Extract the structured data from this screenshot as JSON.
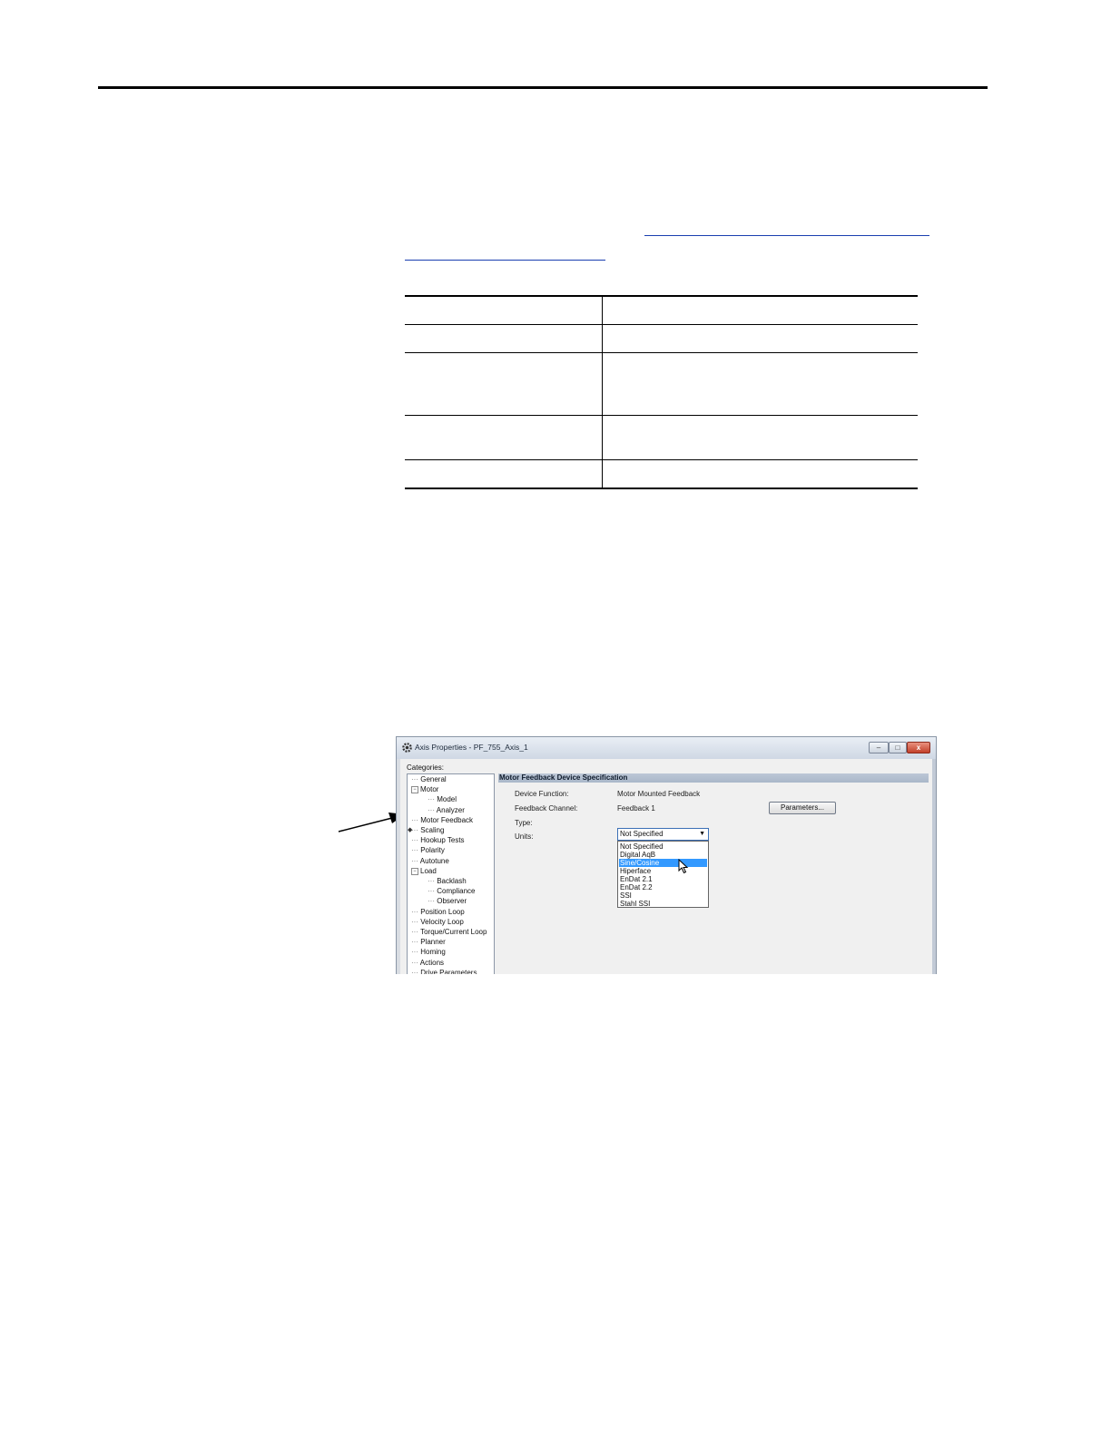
{
  "window": {
    "title": "Axis Properties - PF_755_Axis_1",
    "minimize": "–",
    "maximize": "□",
    "close": "x"
  },
  "categories": {
    "label": "Categories:",
    "items": [
      {
        "label": "General",
        "level": 0
      },
      {
        "label": "Motor",
        "level": 0,
        "expander": "−"
      },
      {
        "label": "Model",
        "level": 1
      },
      {
        "label": "Analyzer",
        "level": 1
      },
      {
        "label": "Motor Feedback",
        "level": 0
      },
      {
        "label": "Scaling",
        "level": 0
      },
      {
        "label": "Hookup Tests",
        "level": 0
      },
      {
        "label": "Polarity",
        "level": 0
      },
      {
        "label": "Autotune",
        "level": 0
      },
      {
        "label": "Load",
        "level": 0,
        "expander": "−"
      },
      {
        "label": "Backlash",
        "level": 1
      },
      {
        "label": "Compliance",
        "level": 1
      },
      {
        "label": "Observer",
        "level": 1
      },
      {
        "label": "Position Loop",
        "level": 0
      },
      {
        "label": "Velocity Loop",
        "level": 0
      },
      {
        "label": "Torque/Current Loop",
        "level": 0
      },
      {
        "label": "Planner",
        "level": 0
      },
      {
        "label": "Homing",
        "level": 0
      },
      {
        "label": "Actions",
        "level": 0
      },
      {
        "label": "Drive Parameters",
        "level": 0
      }
    ],
    "selected_marker": "◆"
  },
  "panel": {
    "header": "Motor Feedback Device Specification",
    "device_function_label": "Device Function:",
    "device_function_value": "Motor Mounted Feedback",
    "feedback_channel_label": "Feedback Channel:",
    "feedback_channel_value": "Feedback 1",
    "type_label": "Type:",
    "units_label": "Units:",
    "parameters_button": "Parameters...",
    "type_selected": "Not Specified",
    "combo_arrow": "▼",
    "type_options": [
      "Not Specified",
      "Digital AqB",
      "Sine/Cosine",
      "Hiperface",
      "EnDat 2.1",
      "EnDat 2.2",
      "SSI",
      "Stahl SSI"
    ],
    "highlighted_option_index": 2
  }
}
